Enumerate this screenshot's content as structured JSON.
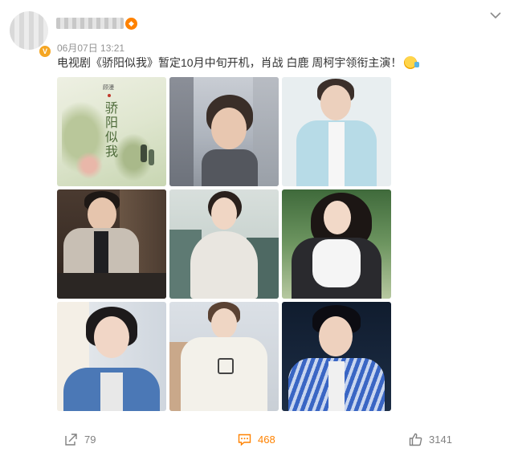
{
  "post": {
    "timestamp": "06月07日 13:21",
    "text": "电视剧《骄阳似我》暂定10月中旬开机，肖战 白鹿 周柯宇领衔主演！",
    "badge_letter": "V"
  },
  "images": [
    {
      "alt": "poster-art"
    },
    {
      "alt": "man-street"
    },
    {
      "alt": "man-light-shirt"
    },
    {
      "alt": "man-trench-coat"
    },
    {
      "alt": "woman-cape"
    },
    {
      "alt": "woman-lace-dress"
    },
    {
      "alt": "woman-denim"
    },
    {
      "alt": "man-white-hoodie"
    },
    {
      "alt": "man-striped-shirt"
    }
  ],
  "poster_text": {
    "title_chars": "骄阳似我",
    "caption": "顾漫"
  },
  "footer": {
    "share_count": "79",
    "comment_count": "468",
    "like_count": "3141"
  },
  "colors": {
    "accent": "#ff8200",
    "meta_grey": "#939393",
    "footer_grey": "#808080"
  }
}
